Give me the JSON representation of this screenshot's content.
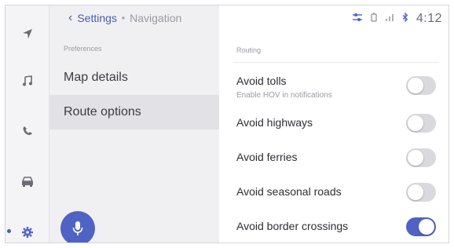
{
  "header": {
    "back_label": "Settings",
    "trail_label": "Navigation"
  },
  "status_bar": {
    "time": "4:12",
    "icons": [
      "sliders-icon",
      "battery-icon",
      "signal-icon",
      "bluetooth-icon"
    ]
  },
  "rail": {
    "items": [
      {
        "name": "navigation",
        "icon": "navigation-arrow-icon"
      },
      {
        "name": "music",
        "icon": "music-note-icon"
      },
      {
        "name": "phone",
        "icon": "phone-icon"
      },
      {
        "name": "car",
        "icon": "car-icon"
      },
      {
        "name": "settings",
        "icon": "gear-icon",
        "active": true
      }
    ]
  },
  "preferences": {
    "section_label": "Preferences",
    "items": [
      {
        "label": "Map details",
        "selected": false
      },
      {
        "label": "Route options",
        "selected": true
      }
    ]
  },
  "routing": {
    "section_label": "Routing",
    "options": [
      {
        "label": "Avoid tolls",
        "sublabel": "Enable HOV in notifications",
        "on": false
      },
      {
        "label": "Avoid highways",
        "on": false
      },
      {
        "label": "Avoid ferries",
        "on": false
      },
      {
        "label": "Avoid seasonal roads",
        "on": false
      },
      {
        "label": "Avoid border crossings",
        "on": true
      }
    ]
  },
  "colors": {
    "accent": "#4f63c4",
    "toggle_off": "#d9d9de"
  }
}
